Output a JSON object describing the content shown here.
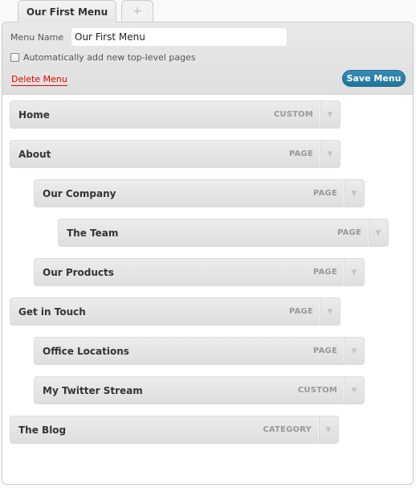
{
  "tabs": {
    "active_label": "Our First Menu",
    "add_label": "+"
  },
  "header": {
    "menu_name_label": "Menu Name",
    "menu_name_value": "Our First Menu",
    "auto_add_label": "Automatically add new top-level pages",
    "auto_add_checked": false,
    "delete_label": "Delete Menu",
    "save_label": "Save Menu"
  },
  "colors": {
    "save_button": "#21759b",
    "delete_link": "#ee0000"
  },
  "menu_items": [
    {
      "title": "Home",
      "type": "CUSTOM",
      "depth": 0
    },
    {
      "title": "About",
      "type": "PAGE",
      "depth": 0
    },
    {
      "title": "Our Company",
      "type": "PAGE",
      "depth": 1
    },
    {
      "title": "The Team",
      "type": "PAGE",
      "depth": 2
    },
    {
      "title": "Our Products",
      "type": "PAGE",
      "depth": 1
    },
    {
      "title": "Get in Touch",
      "type": "PAGE",
      "depth": 0
    },
    {
      "title": "Office Locations",
      "type": "PAGE",
      "depth": 1
    },
    {
      "title": "My Twitter Stream",
      "type": "CUSTOM",
      "depth": 1
    },
    {
      "title": "The Blog",
      "type": "CATEGORY",
      "depth": 0
    }
  ],
  "icons": {
    "item_toggle": "triangle-down-icon"
  }
}
